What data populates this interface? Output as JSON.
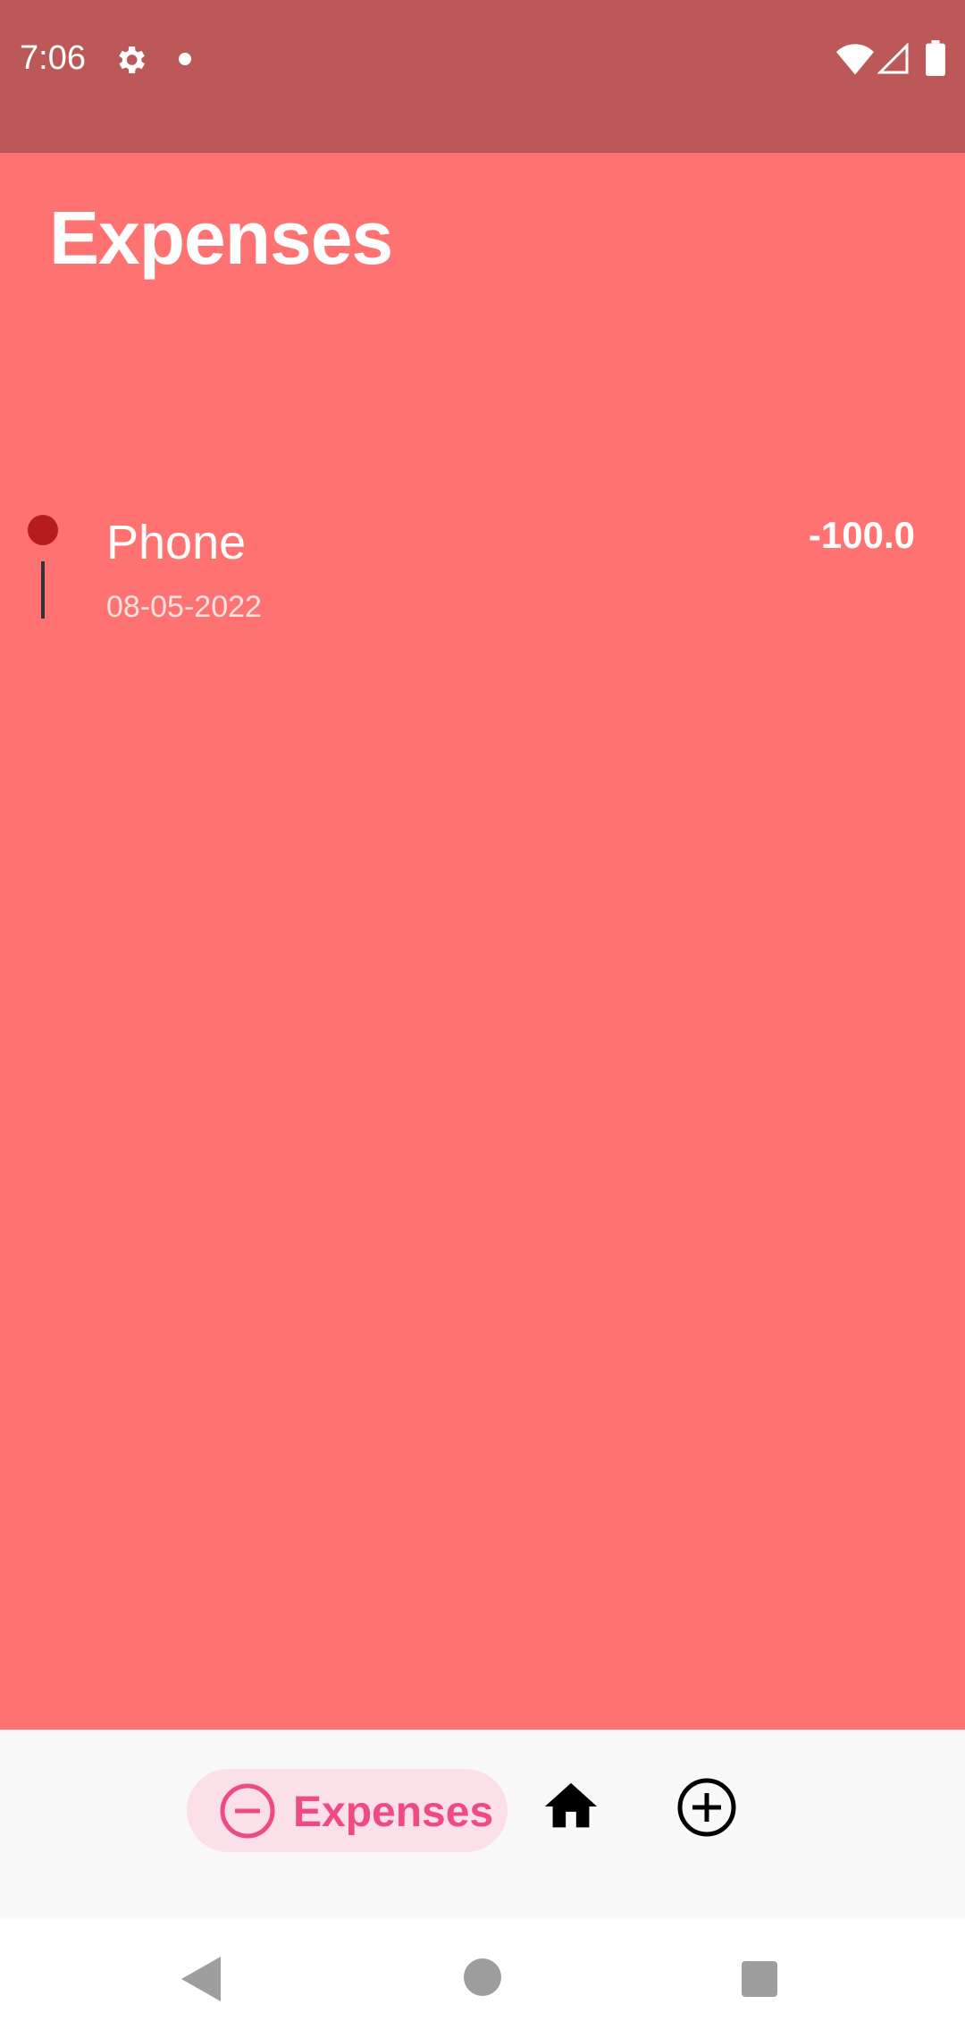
{
  "status_bar": {
    "time": "7:06",
    "icons": [
      "gear-icon",
      "dot-icon",
      "wifi-icon",
      "signal-icon",
      "battery-icon"
    ]
  },
  "page": {
    "title": "Expenses"
  },
  "expenses": [
    {
      "name": "Phone",
      "date": "08-05-2022",
      "amount": "-100.0"
    }
  ],
  "bottom_nav": {
    "items": [
      {
        "label": "Expenses",
        "icon": "minus-circle-icon",
        "active": true
      },
      {
        "label": "",
        "icon": "home-icon",
        "active": false
      },
      {
        "label": "",
        "icon": "add-circle-icon",
        "active": false
      }
    ],
    "active_color": "#ee4b85",
    "active_bg": "#fce0e8"
  },
  "colors": {
    "background": "#ff7272",
    "status_bar": "#bd5858",
    "timeline_dot": "#b71c1c"
  }
}
